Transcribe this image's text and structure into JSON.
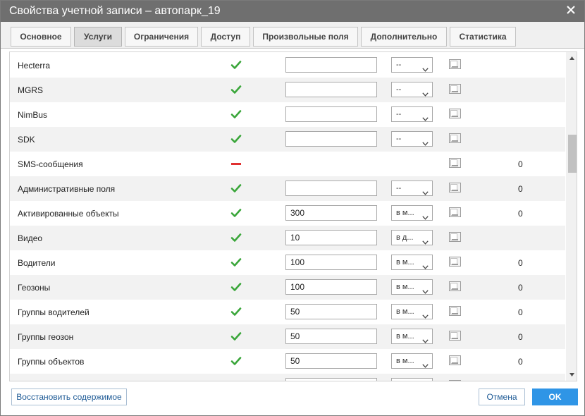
{
  "window": {
    "title": "Свойства учетной записи – автопарк_19"
  },
  "tabs": [
    {
      "label": "Основное"
    },
    {
      "label": "Услуги"
    },
    {
      "label": "Ограничения"
    },
    {
      "label": "Доступ"
    },
    {
      "label": "Произвольные поля"
    },
    {
      "label": "Дополнительно"
    },
    {
      "label": "Статистика"
    }
  ],
  "active_tab": "Услуги",
  "services": [
    {
      "name": "Hecterra",
      "status": "enabled",
      "value": "",
      "unit": "--",
      "count": ""
    },
    {
      "name": "MGRS",
      "status": "enabled",
      "value": "",
      "unit": "--",
      "count": ""
    },
    {
      "name": "NimBus",
      "status": "enabled",
      "value": "",
      "unit": "--",
      "count": ""
    },
    {
      "name": "SDK",
      "status": "enabled",
      "value": "",
      "unit": "--",
      "count": ""
    },
    {
      "name": "SMS-сообщения",
      "status": "disabled",
      "value": null,
      "unit": null,
      "count": "0"
    },
    {
      "name": "Административные поля",
      "status": "enabled",
      "value": "",
      "unit": "--",
      "count": "0"
    },
    {
      "name": "Активированные объекты",
      "status": "enabled",
      "value": "300",
      "unit": "в м...",
      "count": "0"
    },
    {
      "name": "Видео",
      "status": "enabled",
      "value": "10",
      "unit": "в д...",
      "count": ""
    },
    {
      "name": "Водители",
      "status": "enabled",
      "value": "100",
      "unit": "в м...",
      "count": "0"
    },
    {
      "name": "Геозоны",
      "status": "enabled",
      "value": "100",
      "unit": "в м...",
      "count": "0"
    },
    {
      "name": "Группы водителей",
      "status": "enabled",
      "value": "50",
      "unit": "в м...",
      "count": "0"
    },
    {
      "name": "Группы геозон",
      "status": "enabled",
      "value": "50",
      "unit": "в м...",
      "count": "0"
    },
    {
      "name": "Группы объектов",
      "status": "enabled",
      "value": "50",
      "unit": "в м...",
      "count": "0"
    },
    {
      "name": "",
      "status": "",
      "value": "",
      "unit": "",
      "count": ""
    }
  ],
  "footer": {
    "restore_label": "Восстановить содержимое",
    "cancel_label": "Отмена",
    "ok_label": "OK"
  },
  "colors": {
    "titlebar": "#6f6f6f",
    "check": "#3aa63a",
    "disabled_dash": "#e03030",
    "ok_button": "#2f95e6",
    "link_text": "#1f5b96"
  },
  "icons": {
    "close": "close-icon",
    "enabled": "check-icon",
    "disabled": "minus-icon",
    "info": "info-box-icon",
    "dropdown": "chevron-down-icon",
    "scroll_up": "arrow-up-icon",
    "scroll_down": "arrow-down-icon"
  }
}
